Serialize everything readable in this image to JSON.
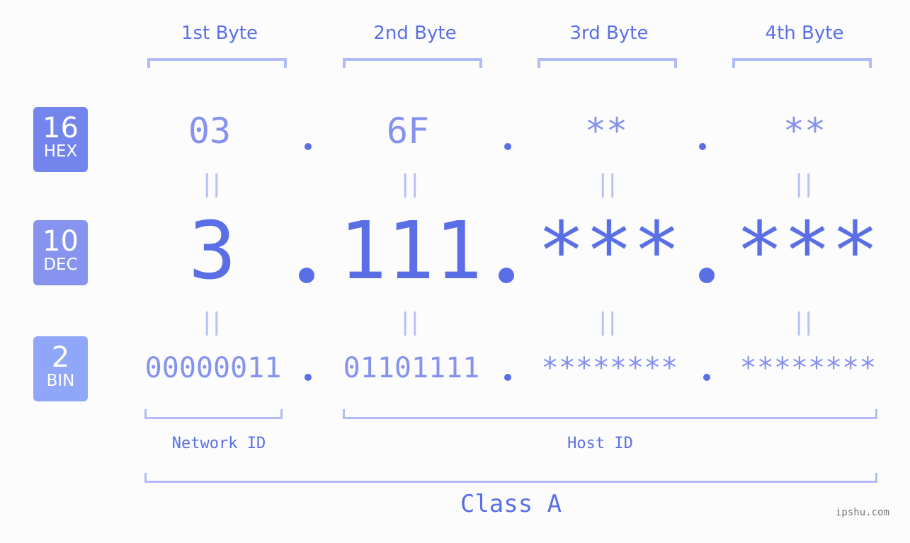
{
  "bytes": {
    "labels": [
      "1st Byte",
      "2nd Byte",
      "3rd Byte",
      "4th Byte"
    ]
  },
  "badges": {
    "hex": {
      "number": "16",
      "base": "HEX",
      "color": "#7384ec"
    },
    "dec": {
      "number": "10",
      "base": "DEC",
      "color": "#8694f0"
    },
    "bin": {
      "number": "2",
      "base": "BIN",
      "color": "#8fa6f9"
    }
  },
  "hex": [
    "03",
    "6F",
    "**",
    "**"
  ],
  "dec": [
    "3",
    "111",
    "***",
    "***"
  ],
  "bin": [
    "00000011",
    "01101111",
    "********",
    "********"
  ],
  "equals_symbol": "||",
  "segments": {
    "network": "Network ID",
    "host": "Host ID"
  },
  "ip_class": "Class A",
  "watermark": "ipshu.com",
  "colors": {
    "accent": "#5a6fe6",
    "light_value": "#8592ee",
    "bracket": "#b1bbf8",
    "equals": "#b6bff5",
    "background": "#fbfcfb"
  }
}
